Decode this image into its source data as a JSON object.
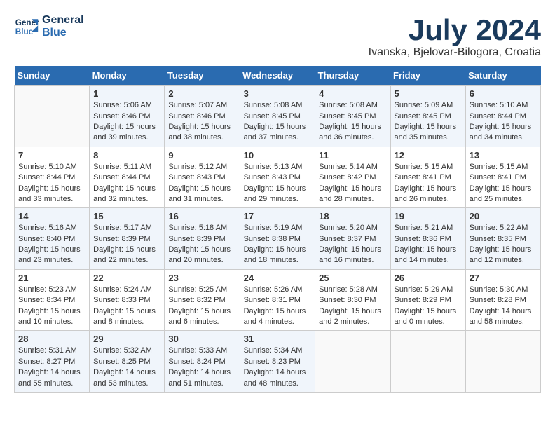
{
  "header": {
    "logo_line1": "General",
    "logo_line2": "Blue",
    "month_year": "July 2024",
    "location": "Ivanska, Bjelovar-Bilogora, Croatia"
  },
  "days_of_week": [
    "Sunday",
    "Monday",
    "Tuesday",
    "Wednesday",
    "Thursday",
    "Friday",
    "Saturday"
  ],
  "weeks": [
    [
      {
        "day": "",
        "content": ""
      },
      {
        "day": "1",
        "content": "Sunrise: 5:06 AM\nSunset: 8:46 PM\nDaylight: 15 hours\nand 39 minutes."
      },
      {
        "day": "2",
        "content": "Sunrise: 5:07 AM\nSunset: 8:46 PM\nDaylight: 15 hours\nand 38 minutes."
      },
      {
        "day": "3",
        "content": "Sunrise: 5:08 AM\nSunset: 8:45 PM\nDaylight: 15 hours\nand 37 minutes."
      },
      {
        "day": "4",
        "content": "Sunrise: 5:08 AM\nSunset: 8:45 PM\nDaylight: 15 hours\nand 36 minutes."
      },
      {
        "day": "5",
        "content": "Sunrise: 5:09 AM\nSunset: 8:45 PM\nDaylight: 15 hours\nand 35 minutes."
      },
      {
        "day": "6",
        "content": "Sunrise: 5:10 AM\nSunset: 8:44 PM\nDaylight: 15 hours\nand 34 minutes."
      }
    ],
    [
      {
        "day": "7",
        "content": "Sunrise: 5:10 AM\nSunset: 8:44 PM\nDaylight: 15 hours\nand 33 minutes."
      },
      {
        "day": "8",
        "content": "Sunrise: 5:11 AM\nSunset: 8:44 PM\nDaylight: 15 hours\nand 32 minutes."
      },
      {
        "day": "9",
        "content": "Sunrise: 5:12 AM\nSunset: 8:43 PM\nDaylight: 15 hours\nand 31 minutes."
      },
      {
        "day": "10",
        "content": "Sunrise: 5:13 AM\nSunset: 8:43 PM\nDaylight: 15 hours\nand 29 minutes."
      },
      {
        "day": "11",
        "content": "Sunrise: 5:14 AM\nSunset: 8:42 PM\nDaylight: 15 hours\nand 28 minutes."
      },
      {
        "day": "12",
        "content": "Sunrise: 5:15 AM\nSunset: 8:41 PM\nDaylight: 15 hours\nand 26 minutes."
      },
      {
        "day": "13",
        "content": "Sunrise: 5:15 AM\nSunset: 8:41 PM\nDaylight: 15 hours\nand 25 minutes."
      }
    ],
    [
      {
        "day": "14",
        "content": "Sunrise: 5:16 AM\nSunset: 8:40 PM\nDaylight: 15 hours\nand 23 minutes."
      },
      {
        "day": "15",
        "content": "Sunrise: 5:17 AM\nSunset: 8:39 PM\nDaylight: 15 hours\nand 22 minutes."
      },
      {
        "day": "16",
        "content": "Sunrise: 5:18 AM\nSunset: 8:39 PM\nDaylight: 15 hours\nand 20 minutes."
      },
      {
        "day": "17",
        "content": "Sunrise: 5:19 AM\nSunset: 8:38 PM\nDaylight: 15 hours\nand 18 minutes."
      },
      {
        "day": "18",
        "content": "Sunrise: 5:20 AM\nSunset: 8:37 PM\nDaylight: 15 hours\nand 16 minutes."
      },
      {
        "day": "19",
        "content": "Sunrise: 5:21 AM\nSunset: 8:36 PM\nDaylight: 15 hours\nand 14 minutes."
      },
      {
        "day": "20",
        "content": "Sunrise: 5:22 AM\nSunset: 8:35 PM\nDaylight: 15 hours\nand 12 minutes."
      }
    ],
    [
      {
        "day": "21",
        "content": "Sunrise: 5:23 AM\nSunset: 8:34 PM\nDaylight: 15 hours\nand 10 minutes."
      },
      {
        "day": "22",
        "content": "Sunrise: 5:24 AM\nSunset: 8:33 PM\nDaylight: 15 hours\nand 8 minutes."
      },
      {
        "day": "23",
        "content": "Sunrise: 5:25 AM\nSunset: 8:32 PM\nDaylight: 15 hours\nand 6 minutes."
      },
      {
        "day": "24",
        "content": "Sunrise: 5:26 AM\nSunset: 8:31 PM\nDaylight: 15 hours\nand 4 minutes."
      },
      {
        "day": "25",
        "content": "Sunrise: 5:28 AM\nSunset: 8:30 PM\nDaylight: 15 hours\nand 2 minutes."
      },
      {
        "day": "26",
        "content": "Sunrise: 5:29 AM\nSunset: 8:29 PM\nDaylight: 15 hours\nand 0 minutes."
      },
      {
        "day": "27",
        "content": "Sunrise: 5:30 AM\nSunset: 8:28 PM\nDaylight: 14 hours\nand 58 minutes."
      }
    ],
    [
      {
        "day": "28",
        "content": "Sunrise: 5:31 AM\nSunset: 8:27 PM\nDaylight: 14 hours\nand 55 minutes."
      },
      {
        "day": "29",
        "content": "Sunrise: 5:32 AM\nSunset: 8:25 PM\nDaylight: 14 hours\nand 53 minutes."
      },
      {
        "day": "30",
        "content": "Sunrise: 5:33 AM\nSunset: 8:24 PM\nDaylight: 14 hours\nand 51 minutes."
      },
      {
        "day": "31",
        "content": "Sunrise: 5:34 AM\nSunset: 8:23 PM\nDaylight: 14 hours\nand 48 minutes."
      },
      {
        "day": "",
        "content": ""
      },
      {
        "day": "",
        "content": ""
      },
      {
        "day": "",
        "content": ""
      }
    ]
  ]
}
